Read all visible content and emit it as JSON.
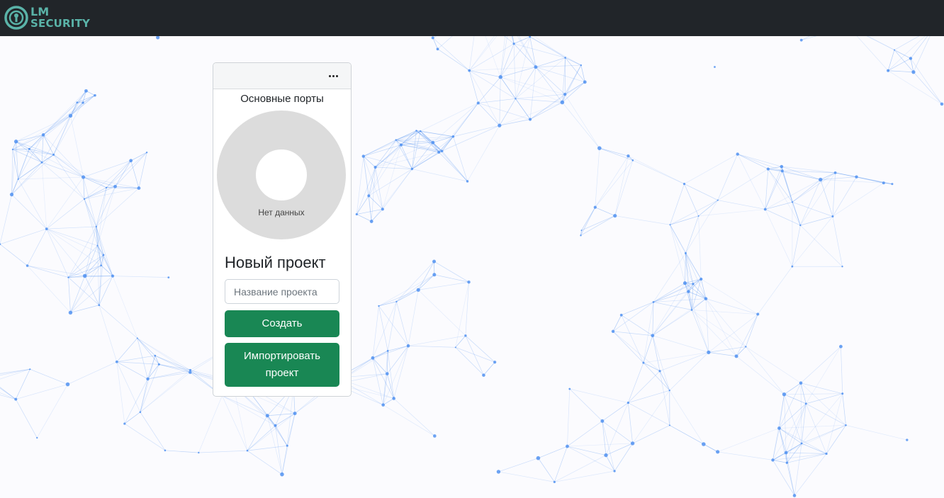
{
  "header": {
    "logo_line1": "LM",
    "logo_line2": "SECURITY",
    "logo_icon": "lock-keyhole-icon",
    "background_color": "#212529",
    "logo_color": "#5ab3a8"
  },
  "card": {
    "menu_icon": "ellipsis-icon",
    "chart_title": "Основные порты",
    "chart_empty_text": "Нет данных",
    "new_project_title": "Новый проект",
    "name_placeholder": "Название проекта",
    "name_value": "",
    "create_label": "Создать",
    "import_label": "Импортировать проект",
    "accent_color": "#198754"
  },
  "chart_data": {
    "type": "pie",
    "categories": [],
    "values": [],
    "empty_state": true
  },
  "background": {
    "pattern": "network-mesh",
    "node_color": "#4a8df0"
  }
}
